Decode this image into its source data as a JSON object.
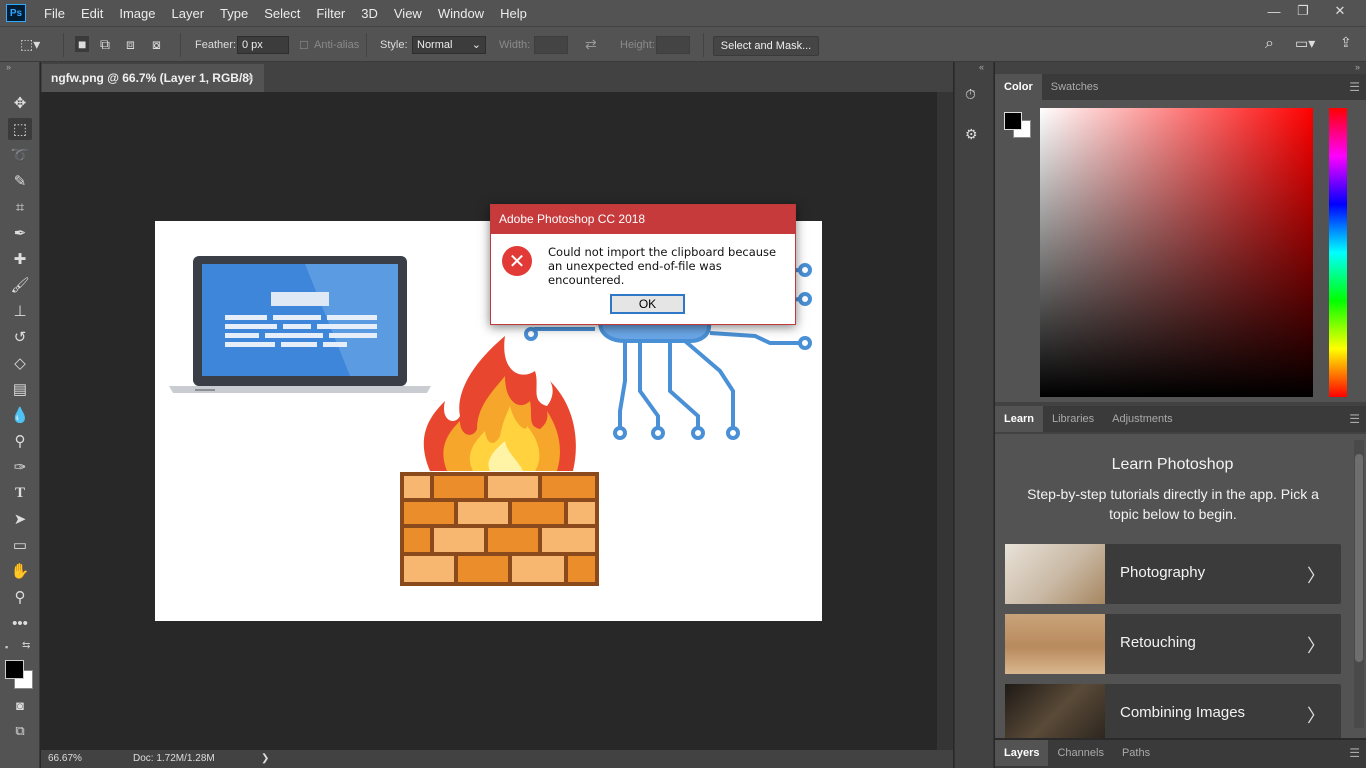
{
  "app": {
    "logo": "Ps"
  },
  "menu": [
    "File",
    "Edit",
    "Image",
    "Layer",
    "Type",
    "Select",
    "Filter",
    "3D",
    "View",
    "Window",
    "Help"
  ],
  "window_controls": {
    "minimize": "—",
    "restore": "❐",
    "close": "✕"
  },
  "options": {
    "feather_label": "Feather:",
    "feather_value": "0 px",
    "antialias_label": "Anti-alias",
    "style_label": "Style:",
    "style_value": "Normal",
    "width_label": "Width:",
    "height_label": "Height:",
    "select_mask_label": "Select and Mask..."
  },
  "document": {
    "tab_title": "ngfw.png @ 66.7% (Layer 1, RGB/8)",
    "tab_close": "×",
    "zoom": "66.67%",
    "doc_size": "Doc: 1.72M/1.28M",
    "status_arrow": "❯"
  },
  "dialog": {
    "title": "Adobe Photoshop CC 2018",
    "message": "Could not import the clipboard because an unexpected end-of-file was encountered.",
    "ok_label": "OK",
    "icon": "error-icon"
  },
  "color_panel": {
    "tabs": [
      "Color",
      "Swatches"
    ],
    "active": "Color",
    "foreground": "#000000",
    "background": "#ffffff",
    "hue": "#ff0000"
  },
  "learn_panel": {
    "tabs": [
      "Learn",
      "Libraries",
      "Adjustments"
    ],
    "active": "Learn",
    "heading": "Learn Photoshop",
    "subheading": "Step-by-step tutorials directly in the app. Pick a topic below to begin.",
    "topics": [
      "Photography",
      "Retouching",
      "Combining Images"
    ]
  },
  "layers_panel": {
    "tabs": [
      "Layers",
      "Channels",
      "Paths"
    ],
    "active": "Layers"
  },
  "colors": {
    "chrome": "#535353",
    "dialog_title_bar": "#c63a3c",
    "accent": "#2f78c8"
  }
}
